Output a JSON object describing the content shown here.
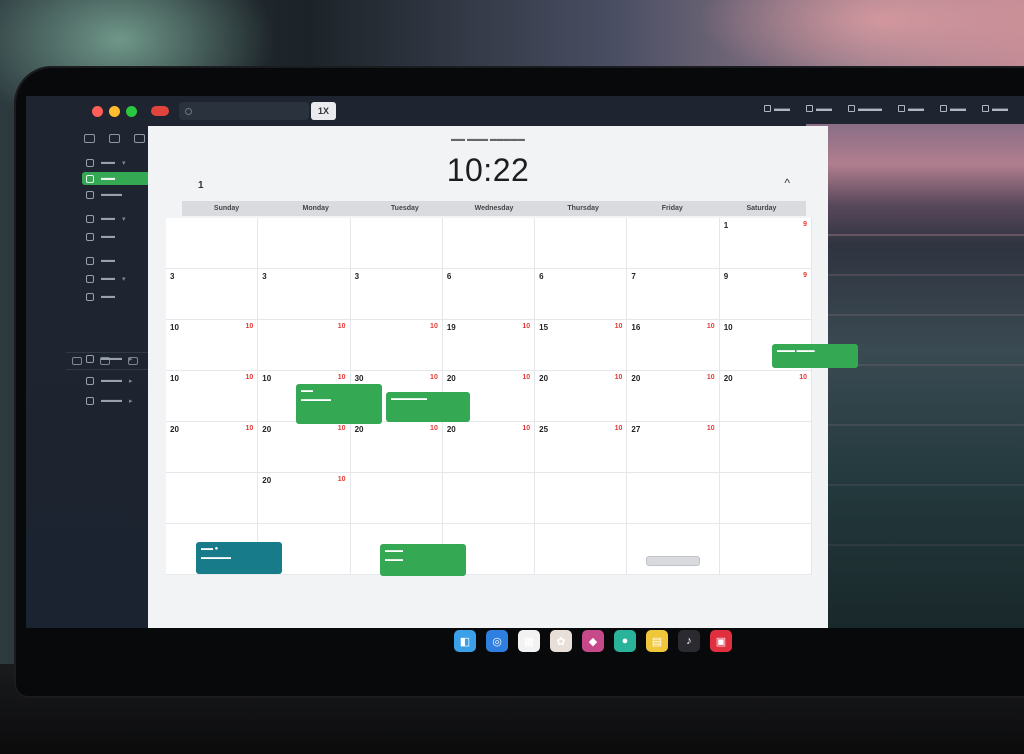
{
  "clock": {
    "time": "10:22"
  },
  "weekdays": [
    "Sunday",
    "Monday",
    "Tuesday",
    "Wednesday",
    "Thursday",
    "Friday",
    "Saturday"
  ],
  "topbar": {
    "button_label": "1X"
  },
  "nav": {
    "prev_label": "1",
    "collapse_glyph": "^"
  },
  "calendar": {
    "weeks": [
      [
        {
          "num": "",
          "flag": ""
        },
        {
          "num": "",
          "flag": ""
        },
        {
          "num": "",
          "flag": ""
        },
        {
          "num": "",
          "flag": ""
        },
        {
          "num": "",
          "flag": ""
        },
        {
          "num": "",
          "flag": ""
        },
        {
          "num": "1",
          "flag": "9"
        }
      ],
      [
        {
          "num": "3",
          "flag": ""
        },
        {
          "num": "3",
          "flag": ""
        },
        {
          "num": "3",
          "flag": ""
        },
        {
          "num": "6",
          "flag": ""
        },
        {
          "num": "6",
          "flag": ""
        },
        {
          "num": "7",
          "flag": ""
        },
        {
          "num": "9",
          "flag": "9"
        }
      ],
      [
        {
          "num": "10",
          "flag": "10"
        },
        {
          "num": "",
          "flag": "10"
        },
        {
          "num": "",
          "flag": "10"
        },
        {
          "num": "19",
          "flag": "10"
        },
        {
          "num": "15",
          "flag": "10"
        },
        {
          "num": "16",
          "flag": "10"
        },
        {
          "num": "10",
          "flag": ""
        }
      ],
      [
        {
          "num": "10",
          "flag": "10"
        },
        {
          "num": "10",
          "flag": "10"
        },
        {
          "num": "30",
          "flag": "10"
        },
        {
          "num": "20",
          "flag": "10"
        },
        {
          "num": "20",
          "flag": "10"
        },
        {
          "num": "20",
          "flag": "10"
        },
        {
          "num": "20",
          "flag": "10"
        }
      ],
      [
        {
          "num": "20",
          "flag": "10"
        },
        {
          "num": "20",
          "flag": "10"
        },
        {
          "num": "20",
          "flag": "10"
        },
        {
          "num": "20",
          "flag": "10"
        },
        {
          "num": "25",
          "flag": "10"
        },
        {
          "num": "27",
          "flag": "10"
        },
        {
          "num": "",
          "flag": ""
        }
      ],
      [
        {
          "num": "",
          "flag": ""
        },
        {
          "num": "20",
          "flag": "10"
        },
        {
          "num": "",
          "flag": ""
        },
        {
          "num": "",
          "flag": ""
        },
        {
          "num": "",
          "flag": ""
        },
        {
          "num": "",
          "flag": ""
        },
        {
          "num": "",
          "flag": ""
        }
      ],
      [
        {
          "num": "",
          "flag": ""
        },
        {
          "num": "",
          "flag": ""
        },
        {
          "num": "",
          "flag": ""
        },
        {
          "num": "",
          "flag": ""
        },
        {
          "num": "",
          "flag": ""
        },
        {
          "num": "",
          "flag": ""
        },
        {
          "num": "",
          "flag": ""
        }
      ]
    ],
    "events": [
      {
        "color": "green",
        "title": ""
      },
      {
        "color": "green",
        "title": ""
      },
      {
        "color": "green",
        "title": ""
      },
      {
        "color": "teal",
        "title": ""
      },
      {
        "color": "green",
        "title": ""
      },
      {
        "color": "orange",
        "title": ""
      }
    ]
  },
  "sidebar_icons": [
    "calendar-icon",
    "list-icon",
    "settings-icon"
  ],
  "dock": [
    {
      "name": "finder-icon",
      "color": "#3aa0e8"
    },
    {
      "name": "safari-icon",
      "color": "#2f7fe0"
    },
    {
      "name": "calendar-app-icon",
      "color": "#f2f2f2"
    },
    {
      "name": "photos-icon",
      "color": "#e8e0d8"
    },
    {
      "name": "app-store-icon",
      "color": "#c64a8a"
    },
    {
      "name": "messages-icon",
      "color": "#29b39a"
    },
    {
      "name": "notes-icon",
      "color": "#f0c73a"
    },
    {
      "name": "music-icon",
      "color": "#2a2a30"
    },
    {
      "name": "news-icon",
      "color": "#e03040"
    }
  ]
}
